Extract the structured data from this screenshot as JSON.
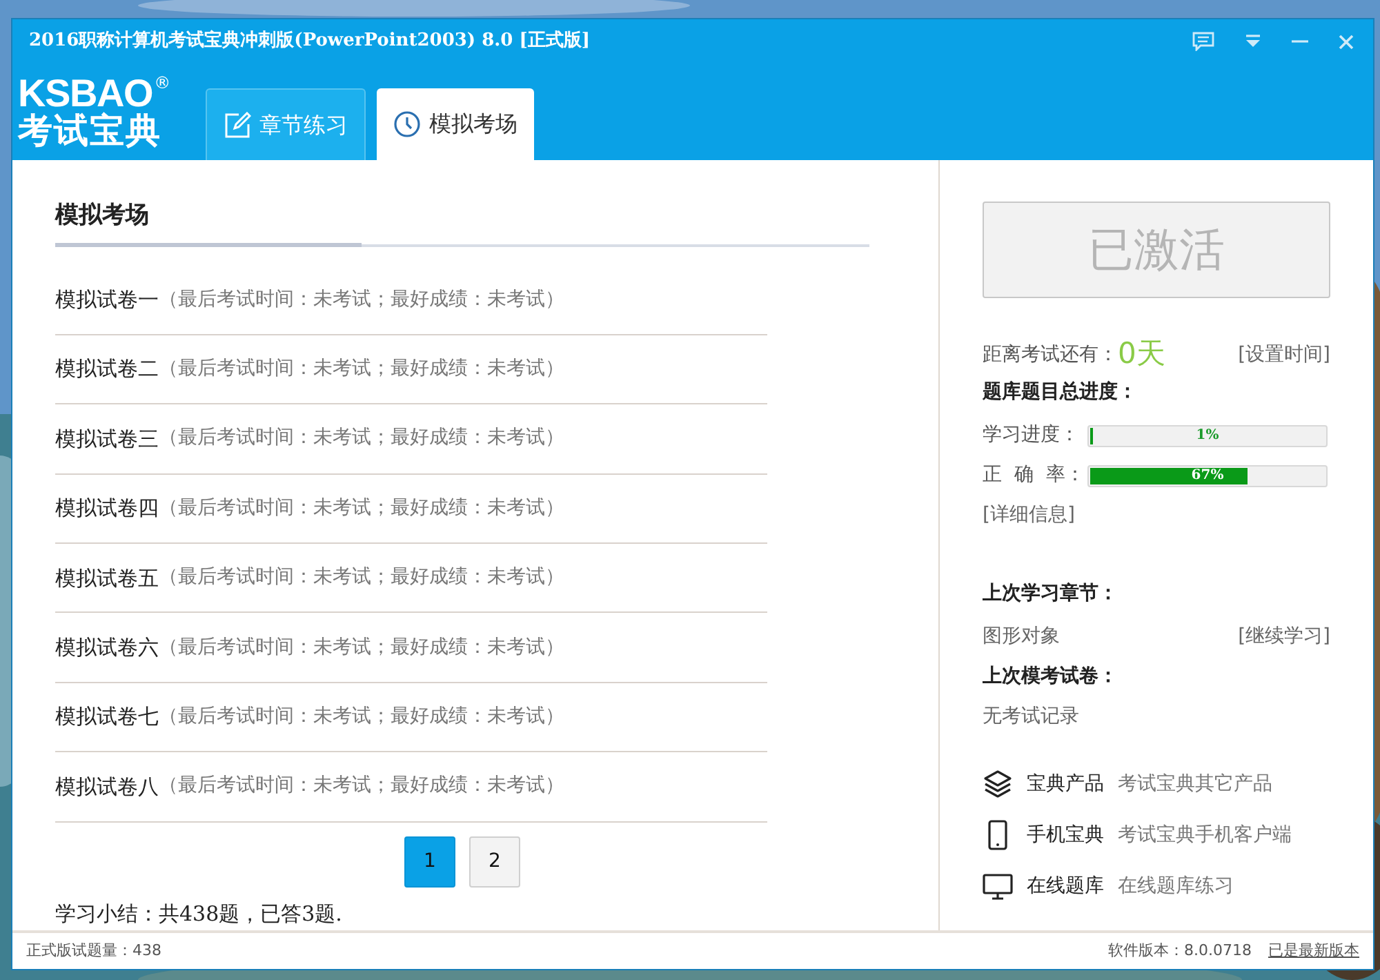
{
  "window": {
    "title": "2016职称计算机考试宝典冲刺版(PowerPoint2003) 8.0 [正式版]"
  },
  "logo": {
    "brand": "KSBAO",
    "mark": "®",
    "subtitle": "考试宝典"
  },
  "tabs": [
    {
      "label": "章节练习",
      "selected": false
    },
    {
      "label": "模拟考场",
      "selected": true
    }
  ],
  "main": {
    "heading": "模拟考场",
    "papers": [
      {
        "name": "模拟试卷一",
        "detail": "（最后考试时间：未考试；最好成绩：未考试）"
      },
      {
        "name": "模拟试卷二",
        "detail": "（最后考试时间：未考试；最好成绩：未考试）"
      },
      {
        "name": "模拟试卷三",
        "detail": "（最后考试时间：未考试；最好成绩：未考试）"
      },
      {
        "name": "模拟试卷四",
        "detail": "（最后考试时间：未考试；最好成绩：未考试）"
      },
      {
        "name": "模拟试卷五",
        "detail": "（最后考试时间：未考试；最好成绩：未考试）"
      },
      {
        "name": "模拟试卷六",
        "detail": "（最后考试时间：未考试；最好成绩：未考试）"
      },
      {
        "name": "模拟试卷七",
        "detail": "（最后考试时间：未考试；最好成绩：未考试）"
      },
      {
        "name": "模拟试卷八",
        "detail": "（最后考试时间：未考试；最好成绩：未考试）"
      }
    ],
    "pages": [
      {
        "label": "1",
        "selected": true
      },
      {
        "label": "2",
        "selected": false
      }
    ],
    "summary": "学习小结：共438题，已答3题."
  },
  "side": {
    "activate_button": "已激活",
    "countdown_label": "距离考试还有：",
    "countdown_value": "0天",
    "set_time": "[设置时间]",
    "progress_heading": "题库题目总进度：",
    "meters": [
      {
        "label": "学习进度：",
        "reading": "1%",
        "level": 0.01
      },
      {
        "label": "正  确  率：",
        "reading": "67%",
        "level": 0.67
      }
    ],
    "details_link": "[详细信息]",
    "last_chapter_heading": "上次学习章节：",
    "last_chapter": "图形对象",
    "continue_link": "[继续学习]",
    "last_exam_heading": "上次模考试卷：",
    "last_exam": "无考试记录",
    "links": [
      {
        "title": "宝典产品",
        "desc": "考试宝典其它产品"
      },
      {
        "title": "手机宝典",
        "desc": "考试宝典手机客户端"
      },
      {
        "title": "在线题库",
        "desc": "在线题库练习"
      }
    ]
  },
  "status_bar": {
    "left": "正式版试题量：438",
    "version": "软件版本：8.0.0718",
    "update_link": "已是最新版本"
  }
}
